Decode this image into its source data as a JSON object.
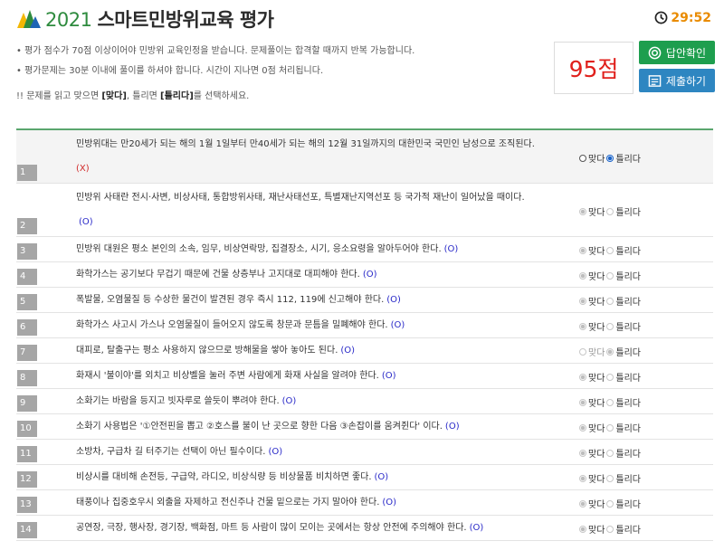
{
  "header": {
    "year": "2021",
    "title": "스마트민방위교육 평가",
    "timer": "29:52"
  },
  "notes": [
    "• 평가 점수가 70점 이상이어야 민방위 교육인정을 받습니다. 문제풀이는 합격할 때까지 반복 가능합니다.",
    "• 평가문제는 30분 이내에 풀이를 하셔야 합니다. 시간이 지나면 0점 처리됩니다."
  ],
  "instruction": {
    "prefix": "!! 문제를 읽고 맞으면 ",
    "yes": "[맞다]",
    "middle": ", 틀리면 ",
    "no": "[틀리다]",
    "suffix": "를 선택하세요."
  },
  "score": "95점",
  "buttons": {
    "answer": "답안확인",
    "submit": "제출하기"
  },
  "options": {
    "yes": "맞다",
    "no": "틀리다"
  },
  "colors": {
    "accent_green": "#1e9e4e",
    "accent_blue": "#2e86c1",
    "score_red": "#e0201c",
    "correct_mark": "#2929c8",
    "wrong_mark": "#d12b2b"
  },
  "questions": [
    {
      "num": "1",
      "text": "민방위대는 만20세가 되는 해의 1월 1일부터 만40세가 되는 해의 12월 31일까지의 대한민국 국민인 남성으로 조직된다.",
      "mark": "(X)",
      "selected": "no"
    },
    {
      "num": "2",
      "text": "민방위 사태란 전시·사변, 비상사태, 통합방위사태, 재난사태선포, 특별재난지역선포 등 국가적 재난이 일어났을 때이다.",
      "mark": "(O)",
      "selected": "yes"
    },
    {
      "num": "3",
      "text": "민방위 대원은 평소 본인의 소속, 임무, 비상연락망, 집결장소, 시기, 응소요령을 알아두어야 한다.",
      "mark": "(O)",
      "selected": "yes"
    },
    {
      "num": "4",
      "text": "화학가스는 공기보다 무겁기 때문에 건물 상층부나 고지대로 대피해야 한다.",
      "mark": "(O)",
      "selected": "yes"
    },
    {
      "num": "5",
      "text": "폭발물, 오염물질 등 수상한 물건이 발견된 경우 즉시 112, 119에 신고해야 한다.",
      "mark": "(O)",
      "selected": "yes"
    },
    {
      "num": "6",
      "text": "화학가스 사고시 가스나 오염물질이 들어오지 않도록 창문과 문틈을 밀폐해야 한다.",
      "mark": "(O)",
      "selected": "yes"
    },
    {
      "num": "7",
      "text": "대피로, 탈출구는 평소 사용하지 않으므로 방해물을 쌓아 놓아도 된다.",
      "mark": "(O)",
      "selected": "no"
    },
    {
      "num": "8",
      "text": "화재시 '불이야'를 외치고 비상벨을 눌러 주변 사람에게 화재 사실을 알려야 한다.",
      "mark": "(O)",
      "selected": "yes"
    },
    {
      "num": "9",
      "text": "소화기는 바람을 등지고 빗자루로 쓸듯이 뿌려야 한다.",
      "mark": "(O)",
      "selected": "yes"
    },
    {
      "num": "10",
      "text": "소화기 사용법은 '①안전핀을 뽑고 ②호스를 불이 난 곳으로 향한 다음 ③손잡이를 움켜쥔다' 이다.",
      "mark": "(O)",
      "selected": "yes"
    },
    {
      "num": "11",
      "text": "소방차, 구급차 길 터주기는 선택이 아닌 필수이다.",
      "mark": "(O)",
      "selected": "yes"
    },
    {
      "num": "12",
      "text": "비상시를 대비해 손전등, 구급약, 라디오, 비상식량 등 비상물품 비치하면 좋다.",
      "mark": "(O)",
      "selected": "yes"
    },
    {
      "num": "13",
      "text": "태풍이나 집중호우시 외출을 자제하고 전신주나 건물 밑으로는 가지 말아야 한다.",
      "mark": "(O)",
      "selected": "yes"
    },
    {
      "num": "14",
      "text": "공연장, 극장, 행사장, 경기장, 백화점, 마트 등 사람이 많이 모이는 곳에서는 항상 안전에 주의해야 한다.",
      "mark": "(O)",
      "selected": "yes"
    }
  ]
}
